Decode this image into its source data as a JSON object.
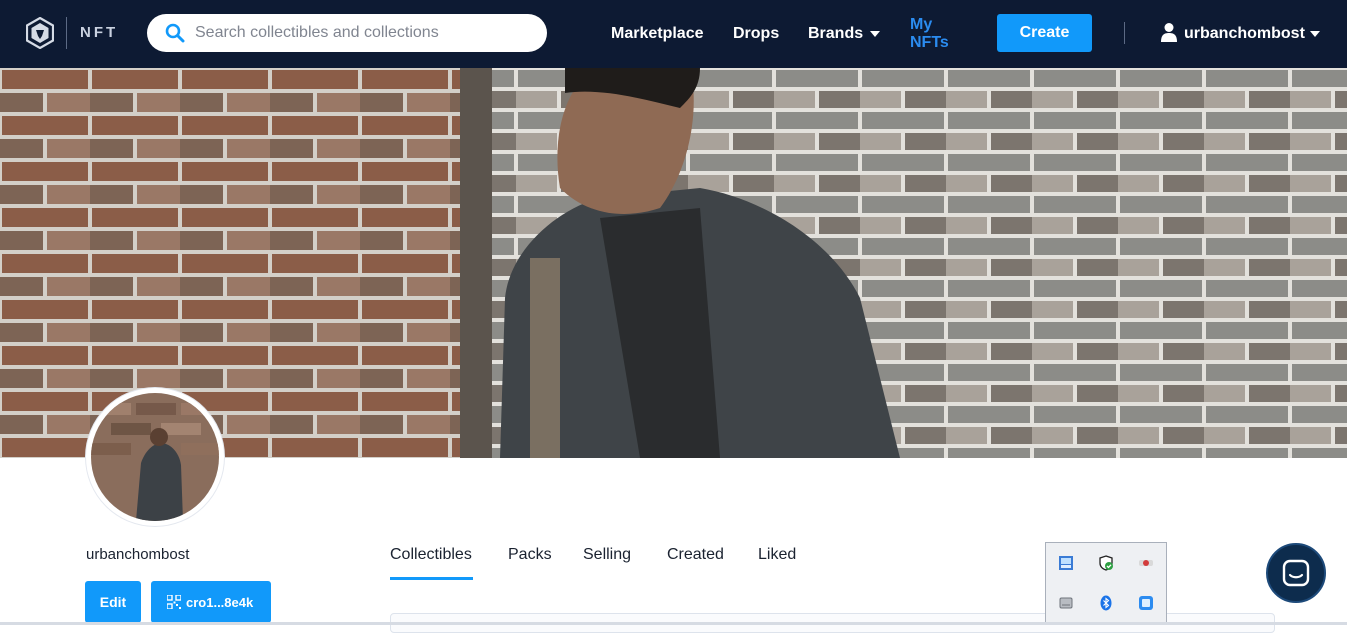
{
  "app": {
    "logo_icon": "crypto-com-logo-icon",
    "logo_text": "NFT"
  },
  "search": {
    "placeholder": "Search collectibles and collections",
    "value": ""
  },
  "nav": {
    "marketplace": "Marketplace",
    "drops": "Drops",
    "brands": "Brands",
    "my_nfts": "My NFTs",
    "create": "Create",
    "username": "urbanchombost"
  },
  "profile": {
    "username": "urbanchombost",
    "edit_label": "Edit",
    "address": "cro1...8e4k"
  },
  "tabs": [
    "Collectibles",
    "Packs",
    "Selling",
    "Created",
    "Liked"
  ],
  "active_tab": "Collectibles",
  "colors": {
    "navbar_bg": "#0d1a33",
    "accent": "#1199fa",
    "active_link": "#2b8cf0"
  },
  "tray_icons": [
    "network-icon",
    "security-shield-icon",
    "antivirus-icon",
    "drive-icon",
    "bluetooth-icon",
    "app-window-icon"
  ]
}
